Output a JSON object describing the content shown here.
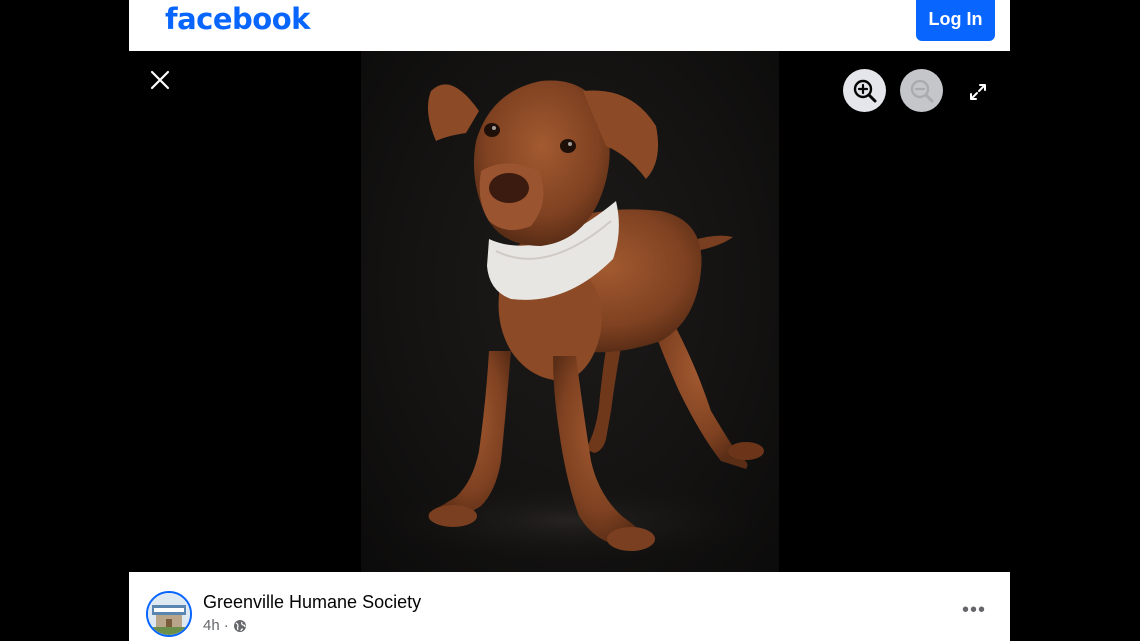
{
  "header": {
    "logo_text": "facebook",
    "login_label": "Log In"
  },
  "viewer": {
    "photo_subject": "Brown puppy wearing a white bandana on black background",
    "icons": {
      "close": "close-icon",
      "zoom_in": "zoom-in-icon",
      "zoom_out": "zoom-out-icon",
      "fullscreen": "fullscreen-icon"
    }
  },
  "post": {
    "author": "Greenville Humane Society",
    "time": "4h",
    "separator": "·",
    "privacy_icon": "globe-icon",
    "more_label": "•••"
  },
  "colors": {
    "brand_blue": "#0866ff",
    "photo_background": "#141312",
    "dog_fur": "#8a4a27",
    "bandana": "#e8e6e2"
  }
}
